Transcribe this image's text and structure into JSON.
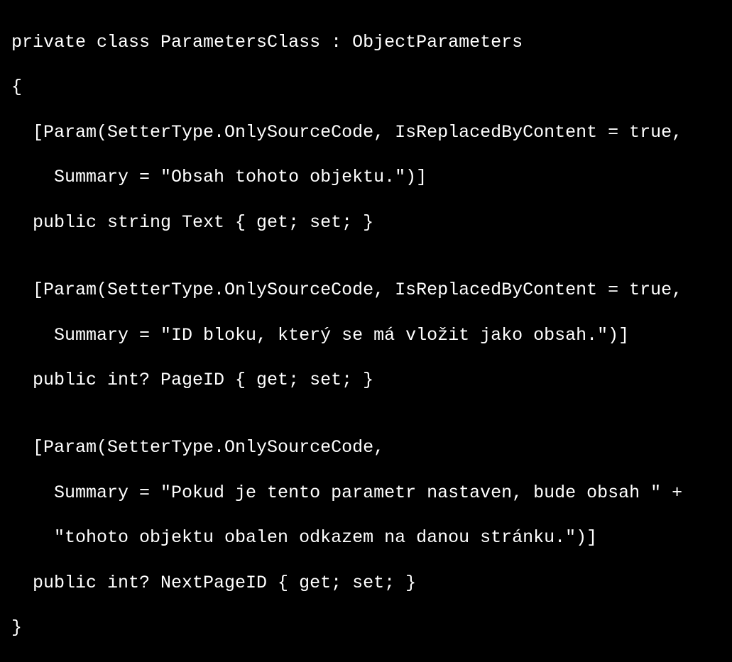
{
  "code": {
    "lines": [
      "private class ParametersClass : ObjectParameters",
      "{",
      "  [Param(SetterType.OnlySourceCode, IsReplacedByContent = true,",
      "    Summary = \"Obsah tohoto objektu.\")]",
      "  public string Text { get; set; }",
      "",
      "  [Param(SetterType.OnlySourceCode, IsReplacedByContent = true,",
      "    Summary = \"ID bloku, který se má vložit jako obsah.\")]",
      "  public int? PageID { get; set; }",
      "",
      "  [Param(SetterType.OnlySourceCode,",
      "    Summary = \"Pokud je tento parametr nastaven, bude obsah \" +",
      "    \"tohoto objektu obalen odkazem na danou stránku.\")]",
      "  public int? NextPageID { get; set; }",
      "}"
    ]
  }
}
